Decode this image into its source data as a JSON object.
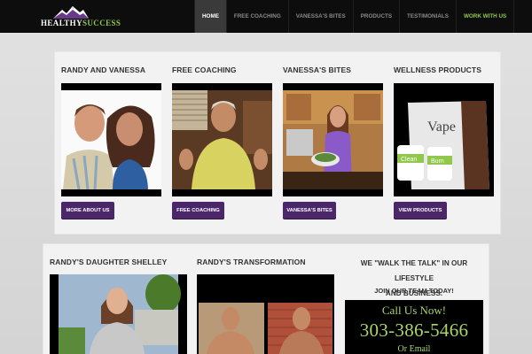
{
  "header": {
    "logo_part1": "HEALTHY",
    "logo_part2": "SUCCESS",
    "nav": [
      {
        "label": "HOME",
        "active": true
      },
      {
        "label": "FREE COACHING"
      },
      {
        "label": "VANESSA'S BITES"
      },
      {
        "label": "PRODUCTS"
      },
      {
        "label": "TESTIMONIALS"
      },
      {
        "label": "WORK WITH US"
      }
    ]
  },
  "cards_top": [
    {
      "title": "RANDY AND VANESSA",
      "button": "MORE ABOUT US"
    },
    {
      "title": "FREE COACHING",
      "button": "FREE COACHING"
    },
    {
      "title": "VANESSA'S BITES",
      "button": "VANESSA'S BITES"
    },
    {
      "title": "WELLNESS PRODUCTS",
      "button": "VIEW PRODUCTS"
    }
  ],
  "cards_bottom": [
    {
      "title": "RANDY'S DAUGHTER SHELLEY"
    },
    {
      "title": "RANDY'S TRANSFORMATION"
    }
  ],
  "cta": {
    "walk_line1": "WE \"WALK THE TALK\" IN OUR LIFESTYLE",
    "walk_line2": "AND BUSINESS.",
    "join": "JOIN OUR TEAM TODAY!",
    "call_now": "Call Us Now!",
    "phone": "303-386-5466",
    "or_email": "Or Email"
  },
  "product_labels": {
    "brand": "Vape",
    "clean": "Clean",
    "burn": "Burn"
  },
  "colors": {
    "accent": "#4b2669",
    "green": "#8fc84a",
    "nav_bg": "#0d0d0d",
    "panel_bg": "#f2f2f2"
  }
}
